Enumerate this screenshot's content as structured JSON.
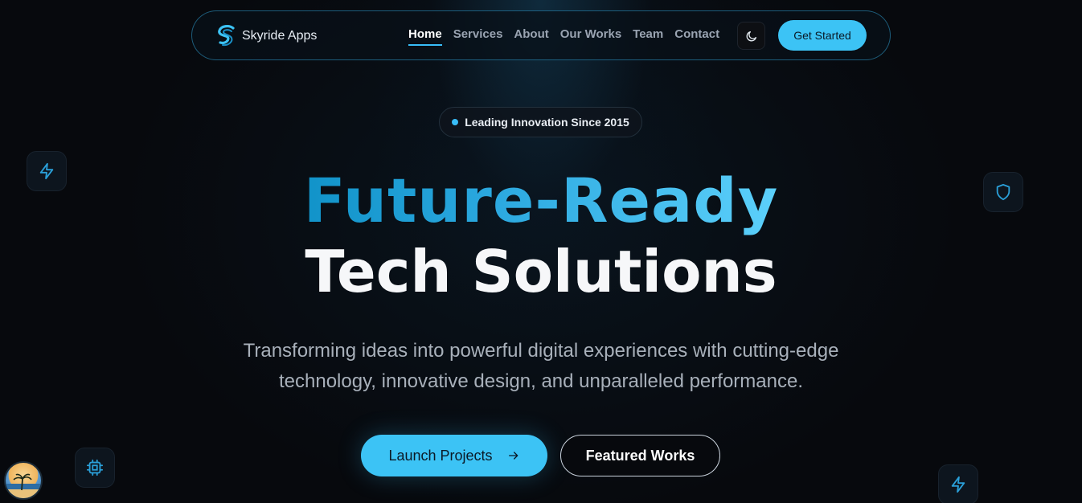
{
  "brand": {
    "name": "Skyride Apps"
  },
  "nav": {
    "links": [
      "Home",
      "Services",
      "About",
      "Our Works",
      "Team",
      "Contact"
    ],
    "active": "Home",
    "cta_label": "Get Started"
  },
  "hero": {
    "badge": "Leading Innovation Since 2015",
    "headline_line1": "Future-Ready",
    "headline_line2": "Tech Solutions",
    "subtitle_line1": "Transforming ideas into powerful digital experiences with cutting-edge",
    "subtitle_line2": "technology, innovative design, and unparalleled performance.",
    "primary_button": "Launch Projects",
    "secondary_button": "Featured Works"
  },
  "icons": {
    "logo": "s-logo-icon",
    "theme": "moon-icon",
    "primary_arrow": "arrow-right-icon",
    "tiles": [
      "lightning-icon",
      "shield-icon",
      "cpu-chip-icon",
      "lightning-icon"
    ],
    "avatar": "avatar"
  },
  "colors": {
    "accent": "#38bdf8",
    "accent_dark": "#1193c9",
    "background": "#07090d"
  }
}
